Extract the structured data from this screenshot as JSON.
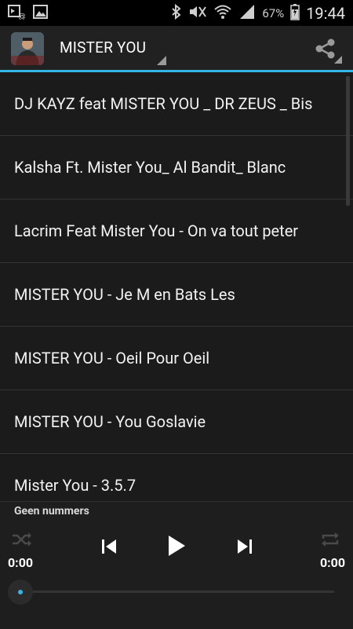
{
  "status_bar": {
    "battery_percent": "67%",
    "time": "19:44"
  },
  "action_bar": {
    "title": "MISTER YOU"
  },
  "songs": [
    "DJ KAYZ feat MISTER YOU _ DR ZEUS _ Bis",
    "Kalsha Ft. Mister You_ Al Bandit_ Blanc",
    "Lacrim Feat Mister You - On va tout peter",
    "MISTER YOU - Je M en Bats Les",
    "MISTER YOU - Oeil Pour Oeil",
    "MISTER YOU - You Goslavie",
    "Mister You - 3.5.7"
  ],
  "player": {
    "now_playing": "Geen nummers",
    "elapsed": "0:00",
    "duration": "0:00",
    "progress": 0
  },
  "colors": {
    "accent": "#33b5e5"
  }
}
